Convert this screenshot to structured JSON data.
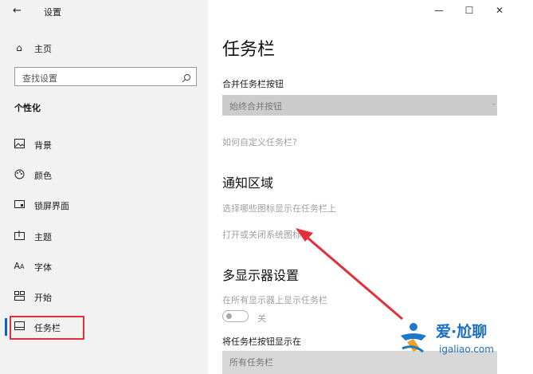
{
  "window": {
    "title": "设置",
    "back_icon": "back-arrow-icon",
    "controls": {
      "minimize": "—",
      "maximize": "☐",
      "close": "✕"
    }
  },
  "sidebar": {
    "home_label": "主页",
    "search_placeholder": "查找设置",
    "section_title": "个性化",
    "items": [
      {
        "label": "背景",
        "icon": "picture-icon"
      },
      {
        "label": "颜色",
        "icon": "palette-icon"
      },
      {
        "label": "锁屏界面",
        "icon": "lock-screen-icon"
      },
      {
        "label": "主题",
        "icon": "theme-icon"
      },
      {
        "label": "字体",
        "icon": "font-icon"
      },
      {
        "label": "开始",
        "icon": "start-icon"
      },
      {
        "label": "任务栏",
        "icon": "taskbar-icon",
        "selected": true
      }
    ]
  },
  "main": {
    "page_title": "任务栏",
    "combine_label": "合并任务栏按钮",
    "combine_value": "始终合并按钮",
    "customize_link": "如何自定义任务栏?",
    "notification_heading": "通知区域",
    "notification_link1": "选择哪些图标显示在任务栏上",
    "notification_link2": "打开或关闭系统图标",
    "multi_heading": "多显示器设置",
    "multi_show_label": "在所有显示器上显示任务栏",
    "toggle_state": "关",
    "show_buttons_label": "将任务栏按钮显示在",
    "show_buttons_value": "所有任务栏"
  },
  "watermark": {
    "brand": "爱·尬聊",
    "domain": "igaliao.com"
  },
  "colors": {
    "highlight_box": "#e0303a",
    "arrow": "#e0303a",
    "accent": "#0a64c8"
  }
}
